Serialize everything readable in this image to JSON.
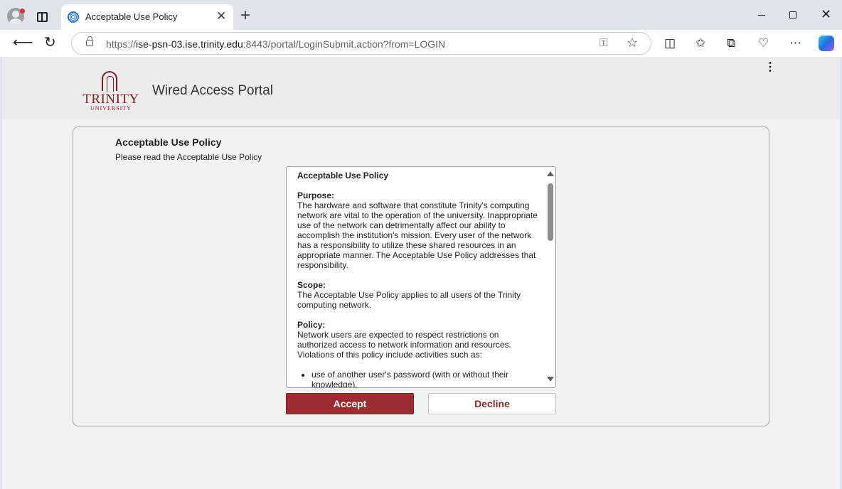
{
  "browser": {
    "tab_title": "Acceptable Use Policy",
    "tab_close": "✕",
    "new_tab": "+",
    "url_scheme": "https://",
    "url_host": "ise-psn-03.ise.trinity.edu",
    "url_rest": ":8443/portal/LoginSubmit.action?from=LOGIN",
    "win_close": "✕"
  },
  "header": {
    "logo_name": "TRINITY",
    "logo_sub": "UNIVERSITY",
    "portal_title": "Wired Access Portal",
    "menu": "⋮"
  },
  "panel": {
    "title": "Acceptable Use Policy",
    "subtitle": "Please read the Acceptable Use Policy"
  },
  "policy": {
    "heading": "Acceptable Use Policy",
    "purpose_label": "Purpose:",
    "purpose_text": "The hardware and software that constitute Trinity's computing network are vital to the operation of the university. Inappropriate use of the network can detrimentally affect our ability to accomplish the institution's mission. Every user of the network has a responsibility to utilize these shared resources in an appropriate manner. The Acceptable Use Policy addresses that responsibility.",
    "scope_label": "Scope:",
    "scope_text": "The Acceptable Use Policy applies to all users of the Trinity computing network.",
    "policy_label": "Policy:",
    "policy_text": "Network users are expected to respect restrictions on authorized access to network information and resources. Violations of this policy include activities such as:",
    "bullets": [
      "use of another user's password (with or without their knowledge)."
    ]
  },
  "actions": {
    "accept": "Accept",
    "decline": "Decline"
  },
  "colors": {
    "brand": "#7d1f22",
    "accept_bg": "#9b2c30"
  }
}
